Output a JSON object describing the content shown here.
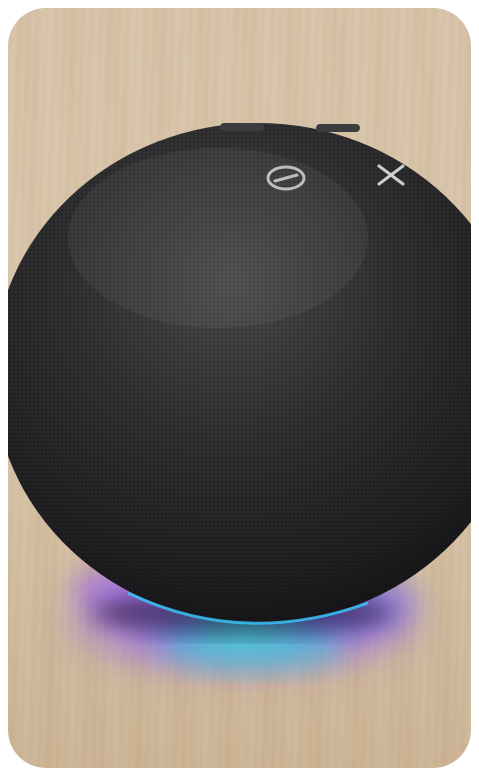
{
  "image": {
    "subject": "smart-speaker-photo",
    "colors": {
      "wood": "#d7c3a7",
      "fabric": "#2b2b2d",
      "fabric_highlight": "#4a4a4c",
      "glow_blue": "#4a5cff",
      "glow_violet": "#8a4dff",
      "glow_cyan": "#35e0d0",
      "button": "#c9c9c9"
    },
    "icons": [
      "mic-off-icon",
      "action-dot-icon"
    ]
  }
}
